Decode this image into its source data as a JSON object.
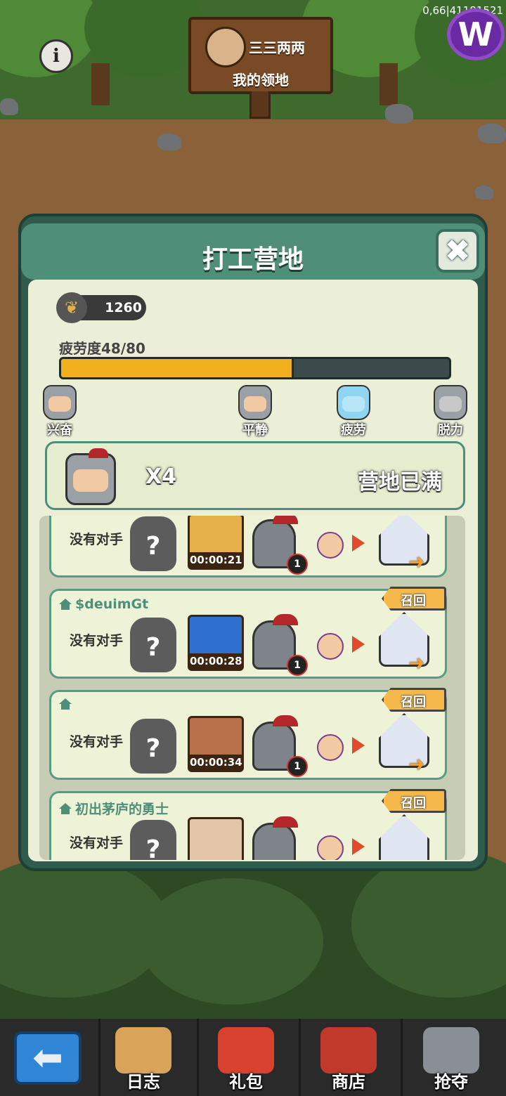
{
  "status_bar": {
    "network_text": "0,66|41181521"
  },
  "top_hud": {
    "player_name": "三三两两",
    "sign_title": "我的领地",
    "info_icon": "info-icon",
    "brand_icon": "w-logo-icon"
  },
  "modal": {
    "title": "打工营地",
    "close_icon": "close-x-icon",
    "grain_value": "1260",
    "fatigue_label": "疲劳度48/80",
    "fatigue": {
      "current": 48,
      "max": 80
    },
    "moods": [
      "兴奋",
      "平静",
      "疲劳",
      "脱力"
    ],
    "banner": {
      "count_text": "X4",
      "status_text": "营地已满"
    }
  },
  "rows": [
    {
      "owner": "",
      "show_owner": false,
      "show_recall": false,
      "no_opponent": "没有对手",
      "mystery": "?",
      "reward": "eggs",
      "timer": "00:00:21",
      "badge": "1",
      "recall": ""
    },
    {
      "owner": "$deuimGt",
      "show_owner": true,
      "show_recall": true,
      "no_opponent": "没有对手",
      "mystery": "?",
      "reward": "gems",
      "timer": "00:00:28",
      "badge": "1",
      "recall": "召回"
    },
    {
      "owner": "",
      "show_owner": true,
      "show_recall": true,
      "no_opponent": "没有对手",
      "mystery": "?",
      "reward": "meat",
      "timer": "00:00:34",
      "badge": "1",
      "recall": "召回"
    },
    {
      "owner": "初出茅庐的勇士",
      "show_owner": true,
      "show_recall": true,
      "no_opponent": "没有对手",
      "mystery": "?",
      "reward": "cloth",
      "timer": "",
      "badge": "",
      "recall": "召回"
    }
  ],
  "bottom_nav": {
    "back_icon": "back-arrow-icon",
    "items": [
      {
        "label": "日志",
        "icon": "scroll-icon"
      },
      {
        "label": "礼包",
        "icon": "gift-bag-icon"
      },
      {
        "label": "商店",
        "icon": "shop-chest-icon"
      },
      {
        "label": "抢夺",
        "icon": "crossed-swords-icon"
      }
    ]
  },
  "colors": {
    "modal_frame": "#2f5b4c",
    "modal_header": "#4f8f7a",
    "panel": "#ecefd8",
    "fatigue_fill": "#f2b01e",
    "recall_tag": "#f5b84a",
    "back_button": "#2f86d6"
  }
}
